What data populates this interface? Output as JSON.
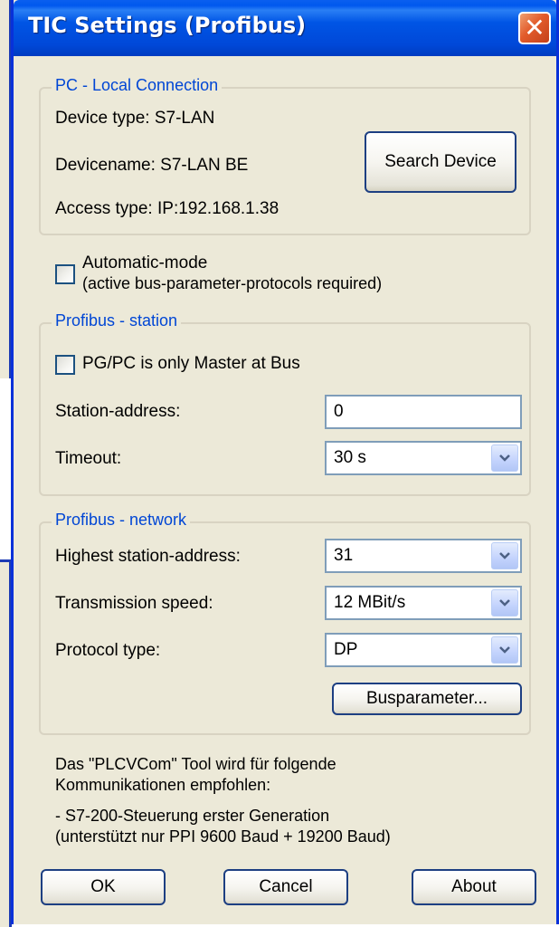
{
  "title": "TIC Settings (Profibus)",
  "close_symbol": "✕",
  "pc_local": {
    "legend": "PC - Local Connection",
    "device_type": "Device type:  S7-LAN",
    "device_name": "Devicename: S7-LAN BE",
    "access_type": "Access type:  IP:192.168.1.38",
    "search_button": "Search Device"
  },
  "automatic_mode": {
    "label_line1": "Automatic-mode",
    "label_line2": "(active bus-parameter-protocols required)",
    "checked": false
  },
  "station": {
    "legend": "Profibus - station",
    "only_master_label": "PG/PC is only Master at Bus",
    "only_master_checked": false,
    "address_label": "Station-address:",
    "address_value": "0",
    "timeout_label": "Timeout:",
    "timeout_value": "30 s"
  },
  "network": {
    "legend": "Profibus - network",
    "highest_label": "Highest station-address:",
    "highest_value": "31",
    "speed_label": "Transmission speed:",
    "speed_value": "12 MBit/s",
    "protocol_label": "Protocol type:",
    "protocol_value": "DP",
    "busparameter_button": "Busparameter..."
  },
  "info": {
    "line1": "Das \"PLCVCom\" Tool wird für folgende",
    "line2": "Kommunikationen empfohlen:",
    "line3": " - S7-200-Steuerung erster Generation",
    "line4": " (unterstützt nur PPI 9600 Baud + 19200 Baud)"
  },
  "buttons": {
    "ok": "OK",
    "cancel": "Cancel",
    "about": "About"
  },
  "colors": {
    "title_bar": "#0055e5",
    "dialog_bg": "#ece9d8",
    "group_legend": "#0046d5",
    "close_button": "#e25b2b"
  },
  "icons": {
    "close": "close-icon",
    "dropdown": "chevron-down-icon"
  }
}
